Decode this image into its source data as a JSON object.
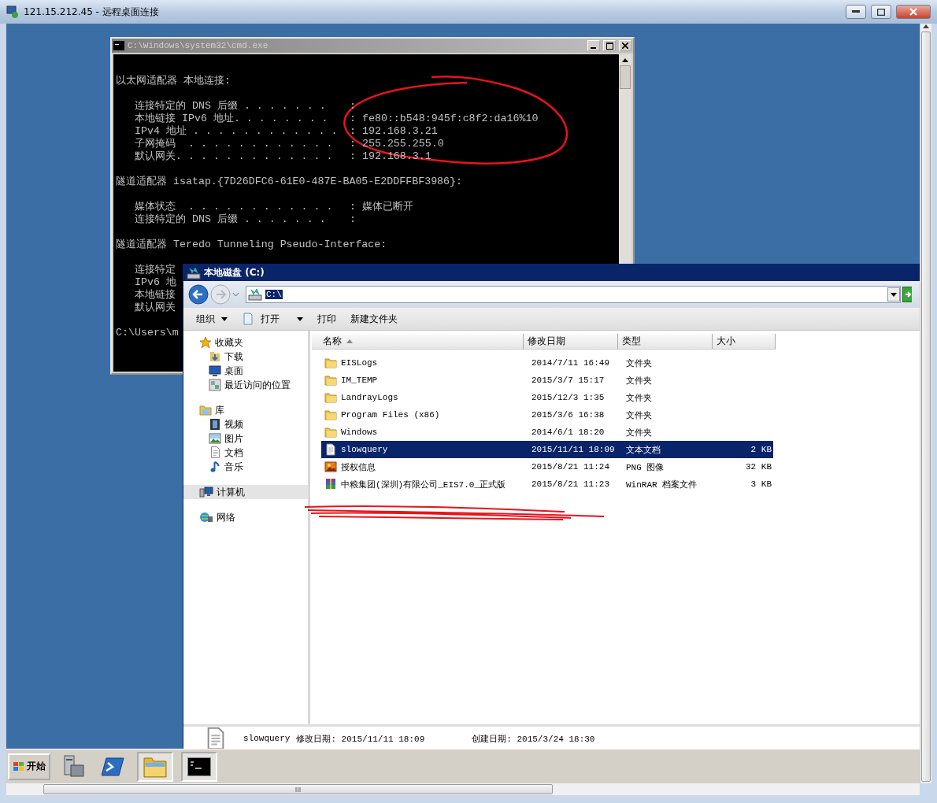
{
  "window": {
    "title": "121.15.212.45 - 远程桌面连接"
  },
  "cmd_window": {
    "title": "C:\\Windows\\system32\\cmd.exe",
    "lines": [
      {
        "kind": "heading",
        "text": "以太网适配器 本地连接:"
      },
      {
        "kind": "blank"
      },
      {
        "kind": "field",
        "label": "连接特定的 DNS 后缀 . . . . . . .",
        "value": ":"
      },
      {
        "kind": "field",
        "label": "本地链接 IPv6 地址. . . . . . . .",
        "value": ": fe80::b548:945f:c8f2:da16%10"
      },
      {
        "kind": "field",
        "label": "IPv4 地址 . . . . . . . . . . . .",
        "value": ": 192.168.3.21"
      },
      {
        "kind": "field",
        "label": "子网掩码  . . . . . . . . . . . .",
        "value": ": 255.255.255.0"
      },
      {
        "kind": "field",
        "label": "默认网关. . . . . . . . . . . . .",
        "value": ": 192.168.3.1"
      },
      {
        "kind": "blank"
      },
      {
        "kind": "heading",
        "text": "隧道适配器 isatap.{7D26DFC6-61E0-487E-BA05-E2DDFFBF3986}:"
      },
      {
        "kind": "blank"
      },
      {
        "kind": "field",
        "label": "媒体状态  . . . . . . . . . . . .",
        "value": ": 媒体已断开"
      },
      {
        "kind": "field",
        "label": "连接特定的 DNS 后缀 . . . . . . .",
        "value": ":"
      },
      {
        "kind": "blank"
      },
      {
        "kind": "heading",
        "text": "隧道适配器 Teredo Tunneling Pseudo-Interface:"
      },
      {
        "kind": "blank"
      },
      {
        "kind": "field",
        "label": "连接特定"
      },
      {
        "kind": "field",
        "label": "IPv6 地"
      },
      {
        "kind": "field",
        "label": "本地链接"
      },
      {
        "kind": "field",
        "label": "默认网关"
      },
      {
        "kind": "blank"
      },
      {
        "kind": "heading",
        "text": "C:\\Users\\m"
      }
    ]
  },
  "explorer_window": {
    "title": "本地磁盘 (C:)",
    "address": "C:\\",
    "toolbar": [
      {
        "kind": "menu",
        "label": "组织"
      },
      {
        "kind": "split",
        "label": "打开"
      },
      {
        "kind": "plain",
        "label": "打印"
      },
      {
        "kind": "plain",
        "label": "新建文件夹"
      }
    ],
    "nav": [
      {
        "label": "收藏夹",
        "selected": false,
        "children": [
          {
            "label": "下载",
            "selected": false
          },
          {
            "label": "桌面",
            "selected": false
          },
          {
            "label": "最近访问的位置",
            "selected": false
          }
        ]
      },
      {
        "label": "库",
        "selected": false,
        "children": [
          {
            "label": "视频",
            "selected": false
          },
          {
            "label": "图片",
            "selected": false
          },
          {
            "label": "文档",
            "selected": false
          },
          {
            "label": "音乐",
            "selected": false
          }
        ]
      },
      {
        "label": "计算机",
        "selected": true
      },
      {
        "label": "网络",
        "selected": false
      }
    ],
    "columns": [
      {
        "label": "名称",
        "sorted": true
      },
      {
        "label": "修改日期",
        "sorted": false
      },
      {
        "label": "类型",
        "sorted": false
      },
      {
        "label": "大小",
        "sorted": false
      }
    ],
    "files": [
      {
        "kind": "folder",
        "name": "EISLogs",
        "modified": "2014/7/11 16:49",
        "type": "文件夹",
        "selected": false
      },
      {
        "kind": "folder",
        "name": "IM_TEMP",
        "modified": "2015/3/7 15:17",
        "type": "文件夹",
        "selected": false
      },
      {
        "kind": "folder",
        "name": "LandrayLogs",
        "modified": "2015/12/3 1:35",
        "type": "文件夹",
        "selected": false
      },
      {
        "kind": "folder",
        "name": "Program Files (x86)",
        "modified": "2015/3/6 16:38",
        "type": "文件夹",
        "selected": false
      },
      {
        "kind": "folder",
        "name": "Windows",
        "modified": "2014/6/1 18:20",
        "type": "文件夹",
        "selected": false
      },
      {
        "kind": "text",
        "name": "slowquery",
        "modified": "2015/11/11 18:09",
        "type": "文本文档",
        "size": "2 KB",
        "selected": true
      },
      {
        "kind": "image",
        "name": "授权信息",
        "modified": "2015/8/21 11:24",
        "type": "PNG 图像",
        "size": "32 KB",
        "selected": false
      },
      {
        "kind": "archive",
        "name": "中粮集团(深圳)有限公司_EIS7.0_正式版",
        "modified": "2015/8/21 11:23",
        "type": "WinRAR 档案文件",
        "size": "3 KB",
        "selected": false
      }
    ],
    "status": {
      "name": "slowquery",
      "modified": "修改日期: 2015/11/11 18:09",
      "created": "创建日期: 2015/3/24 18:30"
    }
  },
  "taskbar": {
    "start": "开始",
    "items": [
      {
        "kind": "launcher"
      },
      {
        "kind": "launcher"
      },
      {
        "kind": "window"
      },
      {
        "kind": "window"
      }
    ]
  }
}
